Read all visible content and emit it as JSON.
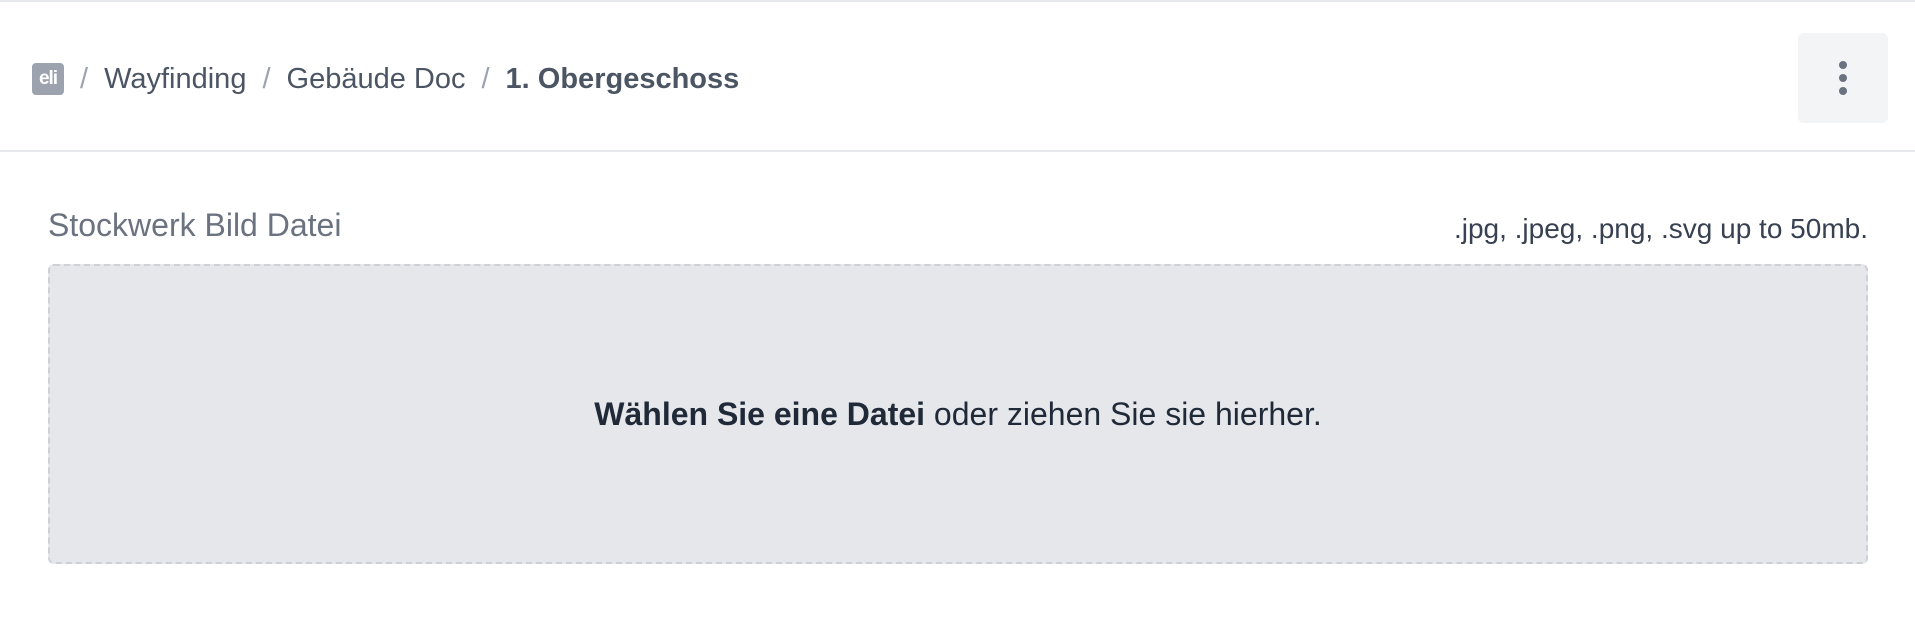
{
  "header": {
    "logo_text": "eli",
    "breadcrumb": {
      "separator": "/",
      "items": [
        {
          "label": "Wayfinding"
        },
        {
          "label": "Gebäude Doc"
        }
      ],
      "current": "1. Obergeschoss"
    },
    "menu_icon": "vertical-ellipsis-icon"
  },
  "upload": {
    "label": "Stockwerk Bild Datei",
    "hint": ".jpg, .jpeg, .png, .svg up to 50mb.",
    "choose_label": "Wählen Sie eine Datei",
    "drop_text": " oder ziehen Sie sie hierher."
  },
  "colors": {
    "dropzone_bg": "#e5e7eb",
    "menu_button_bg": "#f3f4f6",
    "logo_bg": "#9ca3af"
  }
}
